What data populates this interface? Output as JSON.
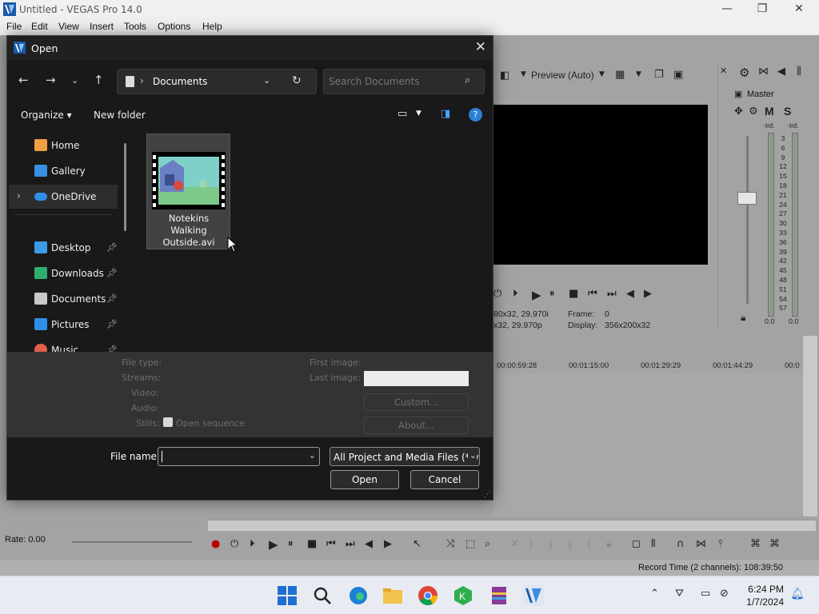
{
  "window": {
    "title": "Untitled - VEGAS Pro 14.0",
    "controls": [
      "—",
      "❐",
      "✕"
    ]
  },
  "menu": [
    "File",
    "Edit",
    "View",
    "Insert",
    "Tools",
    "Options",
    "Help"
  ],
  "preview": {
    "quality": "Preview (Auto)",
    "project_info": "80x32, 29.970i",
    "preview_info": "x32, 29.970p",
    "frame_label": "Frame:",
    "frame_value": "0",
    "display_label": "Display:",
    "display_value": "356x200x32"
  },
  "master": {
    "label": "Master",
    "inf_left": "-Inf.",
    "inf_right": "-Inf.",
    "scale": [
      "3",
      "6",
      "9",
      "12",
      "15",
      "18",
      "21",
      "24",
      "27",
      "30",
      "33",
      "36",
      "39",
      "42",
      "45",
      "48",
      "51",
      "54",
      "57"
    ],
    "bottom_left": "0.0",
    "bottom_right": "0.0"
  },
  "timeline": {
    "ruler": [
      "00:00:59:28",
      "00:01:15:00",
      "00:01:29:29",
      "00:01:44:29",
      "00:0"
    ],
    "rate_label": "Rate: 0.00"
  },
  "status": {
    "record_time": "Record Time (2 channels): 108:39:50"
  },
  "dialog": {
    "title": "Open",
    "location": "Documents",
    "search_placeholder": "Search Documents",
    "organize": "Organize",
    "new_folder": "New folder",
    "nav": [
      {
        "label": "Home",
        "pinned": false
      },
      {
        "label": "Gallery",
        "pinned": false
      },
      {
        "label": "OneDrive",
        "pinned": false
      },
      {
        "label": "Desktop",
        "pinned": true
      },
      {
        "label": "Downloads",
        "pinned": true
      },
      {
        "label": "Documents",
        "pinned": true
      },
      {
        "label": "Pictures",
        "pinned": true
      },
      {
        "label": "Music",
        "pinned": true
      }
    ],
    "file": {
      "line1": "Notekins",
      "line2": "Walking",
      "line3": "Outside.avi"
    },
    "details": {
      "file_type": "File type:",
      "streams": "Streams:",
      "video": "Video:",
      "audio": "Audio:",
      "stills": "Stills:",
      "open_sequence": "Open sequence",
      "first_image": "First image:",
      "last_image": "Last image:",
      "custom": "Custom...",
      "about": "About..."
    },
    "file_name_label": "File name:",
    "file_name_value": "",
    "file_type_value": "All Project and Media Files (*.ve",
    "open_button": "Open",
    "cancel_button": "Cancel"
  },
  "taskbar": {
    "time": "6:24 PM",
    "date": "1/7/2024"
  }
}
